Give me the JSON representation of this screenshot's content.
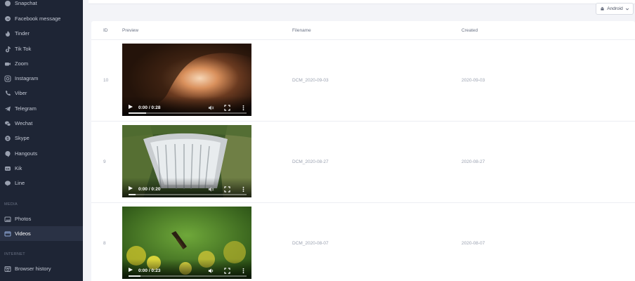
{
  "sidebar": {
    "items_top": [
      {
        "label": "Snapchat",
        "icon": "snapchat-icon"
      },
      {
        "label": "Facebook message",
        "icon": "facebook-messenger-icon"
      },
      {
        "label": "Tinder",
        "icon": "tinder-flame-icon"
      },
      {
        "label": "Tik Tok",
        "icon": "tiktok-icon"
      },
      {
        "label": "Zoom",
        "icon": "zoom-icon"
      },
      {
        "label": "Instagram",
        "icon": "instagram-icon"
      },
      {
        "label": "Viber",
        "icon": "viber-phone-icon"
      },
      {
        "label": "Telegram",
        "icon": "telegram-plane-icon"
      },
      {
        "label": "Wechat",
        "icon": "wechat-icon"
      },
      {
        "label": "Skype",
        "icon": "skype-icon"
      },
      {
        "label": "Hangouts",
        "icon": "hangouts-icon"
      },
      {
        "label": "Kik",
        "icon": "kik-icon"
      },
      {
        "label": "Line",
        "icon": "line-icon"
      }
    ],
    "section_media": "MEDIA",
    "media_items": [
      {
        "label": "Photos",
        "icon": "photos-icon"
      },
      {
        "label": "Videos",
        "icon": "videos-icon",
        "active": true
      }
    ],
    "section_internet": "INTERNET",
    "internet_items": [
      {
        "label": "Browser history",
        "icon": "browser-history-icon"
      }
    ]
  },
  "device_selector": {
    "label": "Android",
    "icon": "android-icon"
  },
  "table": {
    "headers": {
      "id": "ID",
      "preview": "Preview",
      "filename": "Filename",
      "created": "Created"
    },
    "rows": [
      {
        "id": "10",
        "filename": "DCM_2020-09-03",
        "created": "2020-09-03",
        "time": "0:00 / 0:28",
        "progress": 0.15,
        "thumb": "cave-arch"
      },
      {
        "id": "9",
        "filename": "DCM_2020-08-27",
        "created": "2020-08-27",
        "time": "0:00 / 0:20",
        "progress": 0.06,
        "thumb": "waterfall-aerial"
      },
      {
        "id": "8",
        "filename": "DCM_2020-08-07",
        "created": "2020-08-07",
        "time": "0:00 / 0:23",
        "progress": 0.1,
        "thumb": "butterfly-yellow-flowers"
      }
    ]
  },
  "colors": {
    "sidebar_bg": "#1e2535",
    "active_bg": "#2a3245",
    "page_bg": "#f3f4f8"
  }
}
